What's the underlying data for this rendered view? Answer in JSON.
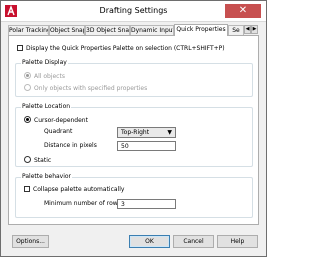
{
  "window": {
    "title": "Drafting Settings",
    "close_glyph": "✕"
  },
  "tabs": [
    {
      "label": "Polar Tracking"
    },
    {
      "label": "Object Snap"
    },
    {
      "label": "3D Object Snap"
    },
    {
      "label": "Dynamic Input"
    },
    {
      "label": "Quick Properties",
      "active": true
    },
    {
      "label": "Se"
    }
  ],
  "tab_scroll": {
    "left": "◀",
    "right": "▶"
  },
  "display_checkbox": {
    "label": "Display the Quick Properties Palette on selection (CTRL+SHIFT+P)",
    "checked": false
  },
  "palette_display": {
    "label": "Palette Display",
    "options": [
      {
        "label": "All objects",
        "checked": true
      },
      {
        "label": "Only objects with specified properties",
        "checked": false
      }
    ]
  },
  "palette_location": {
    "label": "Palette Location",
    "cursor_dependent": {
      "label": "Cursor-dependent",
      "checked": true
    },
    "quadrant": {
      "label": "Quadrant",
      "value": "Top-Right"
    },
    "distance": {
      "label": "Distance in pixels",
      "value": "50"
    },
    "static": {
      "label": "Static",
      "checked": false
    }
  },
  "palette_behavior": {
    "label": "Palette behavior",
    "collapse": {
      "label": "Collapse palette automatically",
      "checked": false
    },
    "min_rows": {
      "label": "Minimum number of rows",
      "value": "3"
    }
  },
  "buttons": {
    "options": "Options...",
    "ok": "OK",
    "cancel": "Cancel",
    "help": "Help"
  },
  "colors": {
    "close": "#c75050",
    "panel": "#ffffff",
    "chrome": "#f0f0f0",
    "disabled_text": "#9a9a9a"
  }
}
